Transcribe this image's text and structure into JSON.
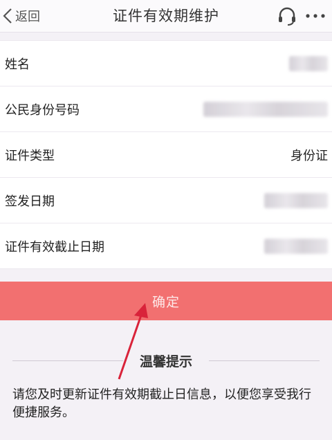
{
  "header": {
    "back_label": "返回",
    "title": "证件有效期维护",
    "icons": [
      "chevron-left-icon",
      "headset-icon",
      "more-icon"
    ]
  },
  "form": {
    "rows": [
      {
        "label": "姓名",
        "value": ""
      },
      {
        "label": "公民身份号码",
        "value": ""
      },
      {
        "label": "证件类型",
        "value": "身份证"
      },
      {
        "label": "签发日期",
        "value": ""
      },
      {
        "label": "证件有效截止日期",
        "value": ""
      }
    ]
  },
  "confirm": {
    "label": "确定"
  },
  "tips": {
    "title": "温馨提示",
    "text": "请您及时更新证件有效期截止日信息，以便您享受我行便捷服务。"
  },
  "colors": {
    "accent": "#f27070",
    "annotation_arrow": "#d9233a"
  }
}
